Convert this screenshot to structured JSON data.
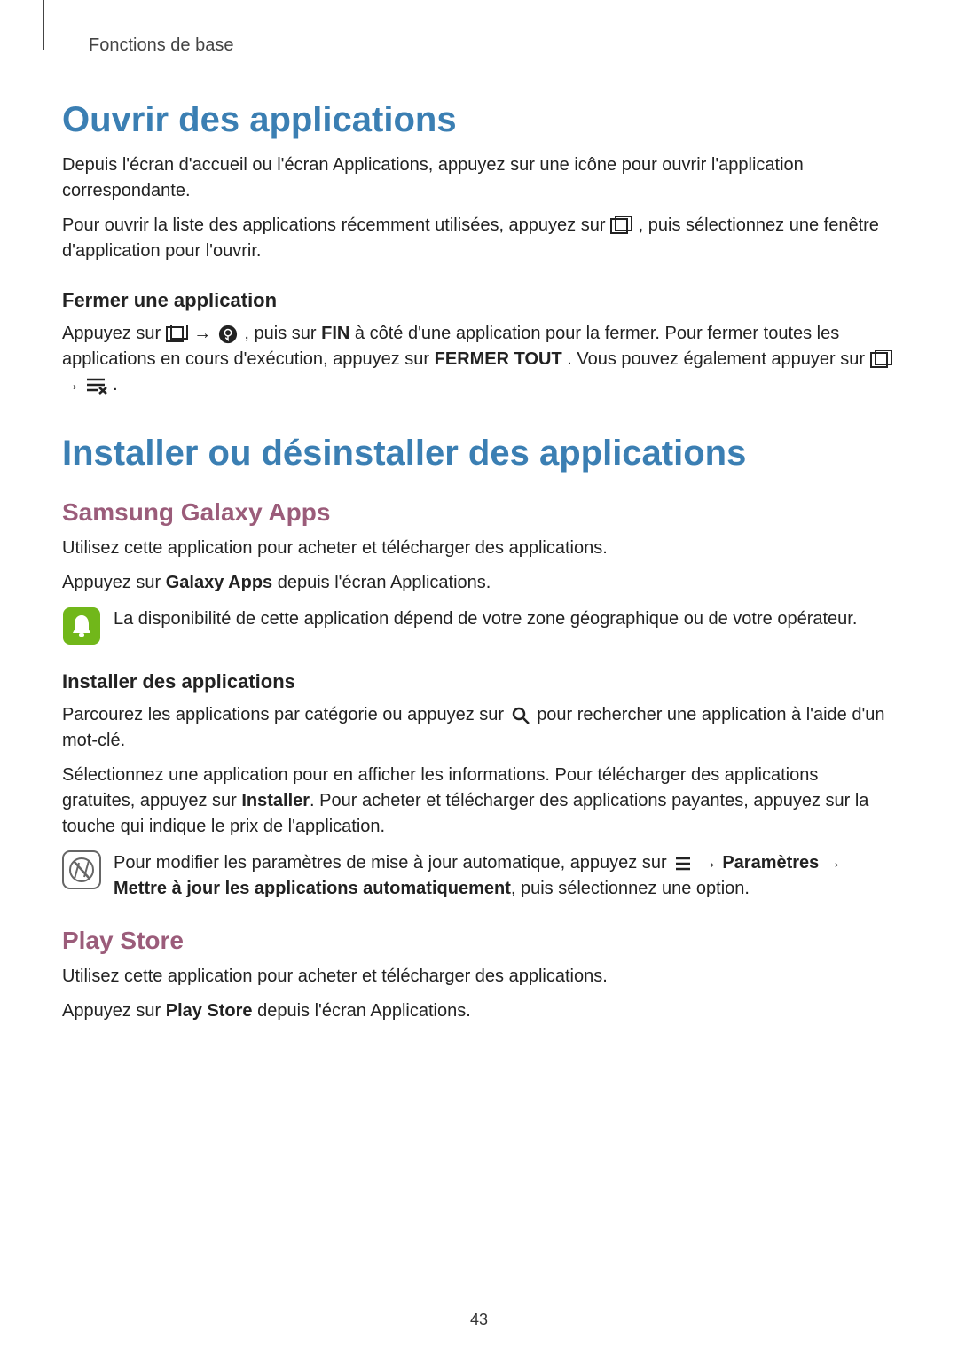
{
  "breadcrumb": "Fonctions de base",
  "h1_open": "Ouvrir des applications",
  "p_open_1": "Depuis l'écran d'accueil ou l'écran Applications, appuyez sur une icône pour ouvrir l'application correspondante.",
  "p_open_2a": "Pour ouvrir la liste des applications récemment utilisées, appuyez sur ",
  "p_open_2b": ", puis sélectionnez une fenêtre d'application pour l'ouvrir.",
  "h3_close": "Fermer une application",
  "p_close_a": "Appuyez sur ",
  "p_close_b": ", puis sur ",
  "p_close_fin": "FIN",
  "p_close_c": " à côté d'une application pour la fermer. Pour fermer toutes les applications en cours d'exécution, appuyez sur ",
  "p_close_fermertout": "FERMER TOUT",
  "p_close_d": ". Vous pouvez également appuyer sur ",
  "p_close_e": ".",
  "h1_install": "Installer ou désinstaller des applications",
  "h2_galaxy": "Samsung Galaxy Apps",
  "p_galaxy_1": "Utilisez cette application pour acheter et télécharger des applications.",
  "p_galaxy_2a": "Appuyez sur ",
  "p_galaxy_2b": "Galaxy Apps",
  "p_galaxy_2c": " depuis l'écran Applications.",
  "note_galaxy": "La disponibilité de cette application dépend de votre zone géographique ou de votre opérateur.",
  "h3_install_apps": "Installer des applications",
  "p_inst_1a": "Parcourez les applications par catégorie ou appuyez sur ",
  "p_inst_1b": " pour rechercher une application à l'aide d'un mot-clé.",
  "p_inst_2a": "Sélectionnez une application pour en afficher les informations. Pour télécharger des applications gratuites, appuyez sur ",
  "p_inst_2b": "Installer",
  "p_inst_2c": ". Pour acheter et télécharger des applications payantes, appuyez sur la touche qui indique le prix de l'application.",
  "note_update_a": "Pour modifier les paramètres de mise à jour automatique, appuyez sur ",
  "note_update_arrow1": " → ",
  "note_update_param": "Paramètres",
  "note_update_arrow2": " → ",
  "note_update_auto": "Mettre à jour les applications automatiquement",
  "note_update_b": ", puis sélectionnez une option.",
  "h2_playstore": "Play Store",
  "p_play_1": "Utilisez cette application pour acheter et télécharger des applications.",
  "p_play_2a": "Appuyez sur ",
  "p_play_2b": "Play Store",
  "p_play_2c": " depuis l'écran Applications.",
  "page_number": "43",
  "arrow": "→"
}
